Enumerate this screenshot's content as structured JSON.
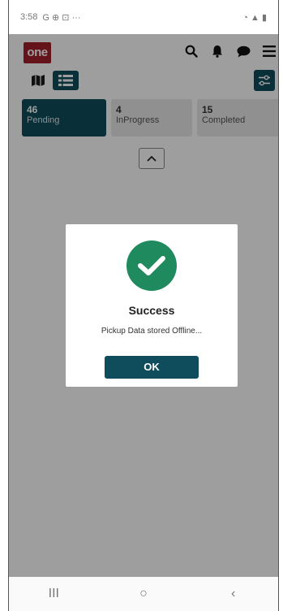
{
  "status_bar": {
    "time": "3:58",
    "icons_left": "G ⊕ ⊡ ···",
    "icons_right": "◔ ▲ ▮"
  },
  "app": {
    "logo_text": "one"
  },
  "tabs": [
    {
      "count": "46",
      "label": "Pending",
      "active": true
    },
    {
      "count": "4",
      "label": "InProgress",
      "active": false
    },
    {
      "count": "15",
      "label": "Completed",
      "active": false
    }
  ],
  "dialog": {
    "title": "Success",
    "message": "Pickup Data stored Offline...",
    "ok_label": "OK"
  },
  "nav": {
    "recent": "III",
    "home": "○",
    "back": "‹"
  },
  "colors": {
    "brand_red": "#a41f2b",
    "teal": "#0f4c5c",
    "success_green": "#1e8a5e"
  },
  "icons": [
    "search-icon",
    "bell-icon",
    "chat-icon",
    "menu-icon",
    "map-icon",
    "list-icon",
    "filter-icon",
    "chevron-up-icon",
    "check-icon"
  ]
}
